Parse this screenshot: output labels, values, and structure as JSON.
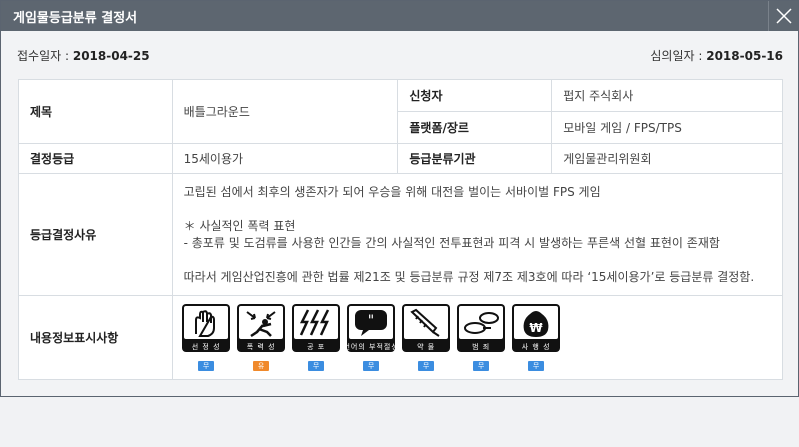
{
  "title": "게임물등급분류 결정서",
  "dates": {
    "received_label": "접수일자 : ",
    "received_value": "2018-04-25",
    "review_label": "심의일자 : ",
    "review_value": "2018-05-16"
  },
  "table": {
    "title_label": "제목",
    "title_value": "배틀그라운드",
    "applicant_label": "신청자",
    "applicant_value": "펍지 주식회사",
    "platform_label": "플랫폼/장르",
    "platform_value": "모바일 게임 /  FPS/TPS",
    "grade_label": "결정등급",
    "grade_value": "15세이용가",
    "agency_label": "등급분류기관",
    "agency_value": "게임물관리위원회",
    "reason_label": "등급결정사유",
    "reason_lines": [
      "고립된 섬에서 최후의 생존자가 되어 우승을 위해 대전을 벌이는 서바이벌 FPS 게임",
      "",
      "＊ 사실적인 폭력 표현",
      "- 총포류 및 도검류를 사용한 인간들 간의 사실적인 전투표현과 피격 시 발생하는 푸른색 선혈 표현이 존재함",
      "",
      "따라서 게임산업진흥에 관한 법률 제21조 및 등급분류 규정 제7조 제3호에 따라 ‘15세이용가’로 등급분류 결정함."
    ],
    "content_label": "내용정보표시사항"
  },
  "descriptors": [
    {
      "label": "선 정 성",
      "badge": "무",
      "badge_color": "#3b8de0",
      "icon": "sexuality-icon"
    },
    {
      "label": "폭 력 성",
      "badge": "유",
      "badge_color": "#f0892b",
      "icon": "violence-icon"
    },
    {
      "label": "공    포",
      "badge": "무",
      "badge_color": "#3b8de0",
      "icon": "fear-icon"
    },
    {
      "label": "언어의 부적절성",
      "badge": "무",
      "badge_color": "#3b8de0",
      "icon": "language-icon"
    },
    {
      "label": "약    물",
      "badge": "무",
      "badge_color": "#3b8de0",
      "icon": "drug-icon"
    },
    {
      "label": "범    죄",
      "badge": "무",
      "badge_color": "#3b8de0",
      "icon": "crime-icon"
    },
    {
      "label": "사 행 성",
      "badge": "무",
      "badge_color": "#3b8de0",
      "icon": "gambling-icon"
    }
  ]
}
